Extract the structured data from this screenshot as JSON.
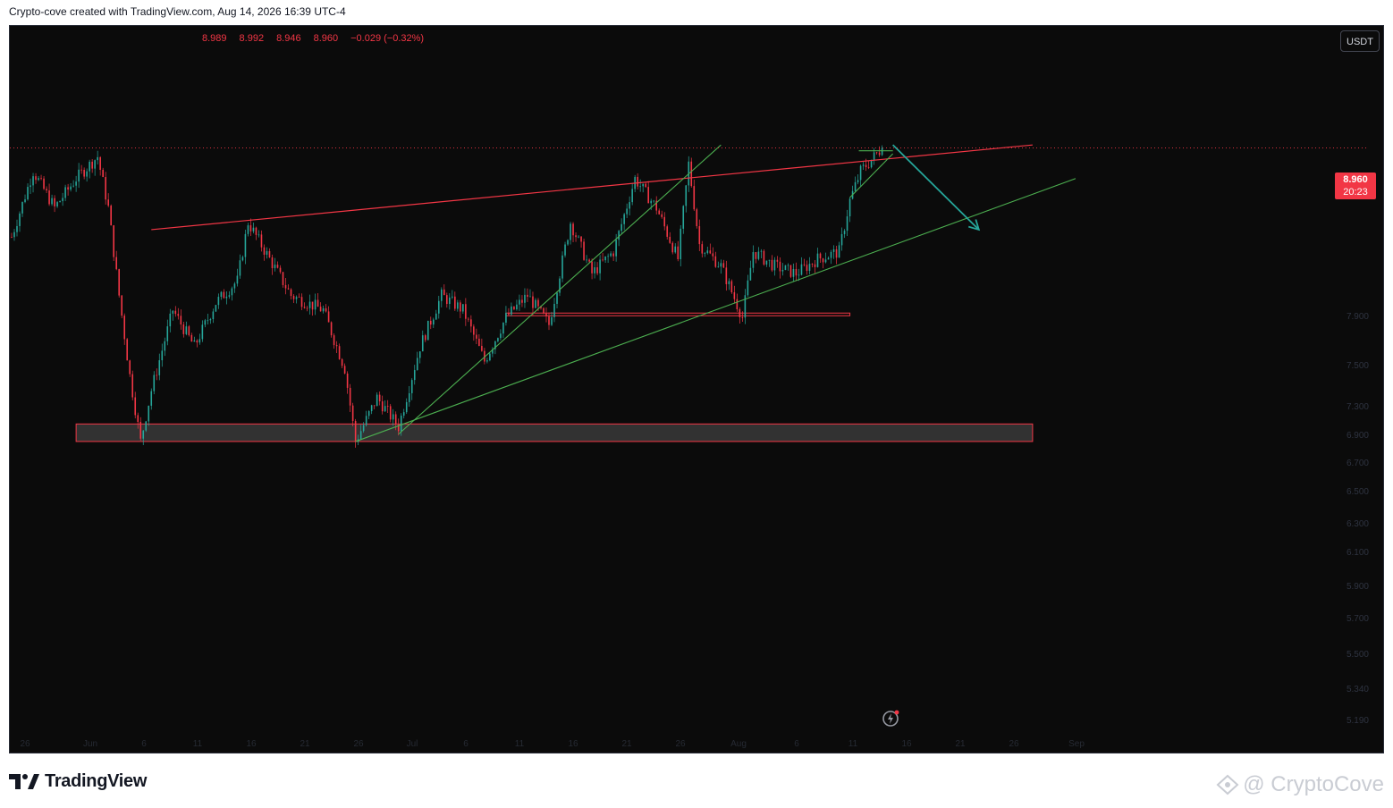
{
  "header": {
    "text": "Crypto-cove created with TradingView.com, Aug 14, 2026 16:39 UTC-4"
  },
  "ohlc": {
    "open": "8.989",
    "high": "8.992",
    "low": "8.946",
    "close": "8.960",
    "change": "−0.029 (−0.32%)"
  },
  "unit_label": "USDT",
  "last_price": {
    "value": "8.960",
    "countdown": "20:23"
  },
  "colors": {
    "background": "#0b0b0b",
    "up": "#26a69a",
    "down": "#f23645",
    "resistance": "#f23645",
    "support": "#4caf50",
    "arrow": "#26a69a"
  },
  "chart_data": {
    "type": "candlestick",
    "timeframe_note": "intraday candles, late May to mid Aug",
    "x_ticks": [
      "26",
      "Jun",
      "6",
      "11",
      "16",
      "21",
      "26",
      "Jul",
      "6",
      "11",
      "16",
      "21",
      "26",
      "Aug",
      "6",
      "11",
      "16",
      "21",
      "26",
      "Sep"
    ],
    "y_ticks": [
      "7.900",
      "7.500",
      "7.300",
      "6.900",
      "6.700",
      "6.500",
      "6.300",
      "6.100",
      "5.900",
      "5.700",
      "5.500",
      "5.340",
      "5.190"
    ],
    "last": 8.96,
    "price_path": [
      [
        "May 25",
        8.35
      ],
      [
        "May 27",
        8.8
      ],
      [
        "May 29",
        8.55
      ],
      [
        "May 31",
        8.75
      ],
      [
        "Jun 02",
        8.9
      ],
      [
        "Jun 03",
        8.55
      ],
      [
        "Jun 04",
        7.95
      ],
      [
        "Jun 05",
        7.4
      ],
      [
        "Jun 06",
        6.95
      ],
      [
        "Jun 07",
        7.3
      ],
      [
        "Jun 09",
        7.85
      ],
      [
        "Jun 11",
        7.6
      ],
      [
        "Jun 13",
        7.9
      ],
      [
        "Jun 15",
        8.05
      ],
      [
        "Jun 16",
        8.45
      ],
      [
        "Jun 18",
        8.2
      ],
      [
        "Jun 20",
        7.95
      ],
      [
        "Jun 23",
        7.85
      ],
      [
        "Jun 25",
        7.45
      ],
      [
        "Jun 26",
        6.95
      ],
      [
        "Jun 28",
        7.25
      ],
      [
        "Jun 30",
        7.05
      ],
      [
        "Jul 02",
        7.6
      ],
      [
        "Jul 04",
        7.95
      ],
      [
        "Jul 06",
        7.85
      ],
      [
        "Jul 08",
        7.5
      ],
      [
        "Jul 10",
        7.8
      ],
      [
        "Jul 12",
        7.95
      ],
      [
        "Jul 14",
        7.75
      ],
      [
        "Jul 16",
        8.45
      ],
      [
        "Jul 18",
        8.1
      ],
      [
        "Jul 20",
        8.25
      ],
      [
        "Jul 22",
        8.75
      ],
      [
        "Jul 24",
        8.55
      ],
      [
        "Jul 26",
        8.2
      ],
      [
        "Jul 27",
        8.85
      ],
      [
        "Jul 28",
        8.3
      ],
      [
        "Jul 30",
        8.15
      ],
      [
        "Aug 01",
        7.8
      ],
      [
        "Aug 02",
        8.25
      ],
      [
        "Aug 04",
        8.15
      ],
      [
        "Aug 06",
        8.1
      ],
      [
        "Aug 08",
        8.2
      ],
      [
        "Aug 10",
        8.25
      ],
      [
        "Aug 11",
        8.6
      ],
      [
        "Aug 12",
        8.8
      ],
      [
        "Aug 14",
        8.96
      ]
    ],
    "drawings": [
      {
        "kind": "resistance-line",
        "from": [
          "Jun 07",
          8.4
        ],
        "to": [
          "Aug 28",
          8.98
        ]
      },
      {
        "kind": "support-line",
        "from": [
          "Jun 26",
          6.95
        ],
        "to": [
          "Sep 01",
          8.75
        ]
      },
      {
        "kind": "trend-line",
        "from": [
          "Jun 30",
          7.0
        ],
        "to": [
          "Jul 30",
          8.98
        ]
      },
      {
        "kind": "horizontal-level",
        "value": 7.82,
        "from": "Jul 10",
        "to": "Aug 11"
      },
      {
        "kind": "support-zone",
        "low": 6.95,
        "high": 7.07,
        "from": "May 31",
        "to": "Aug 28"
      },
      {
        "kind": "projection-arrow",
        "from": [
          "Aug 15",
          8.98
        ],
        "to": [
          "Aug 23",
          8.4
        ]
      },
      {
        "kind": "rising-wedge",
        "from": "Aug 11",
        "to": "Aug 15"
      }
    ]
  }
}
